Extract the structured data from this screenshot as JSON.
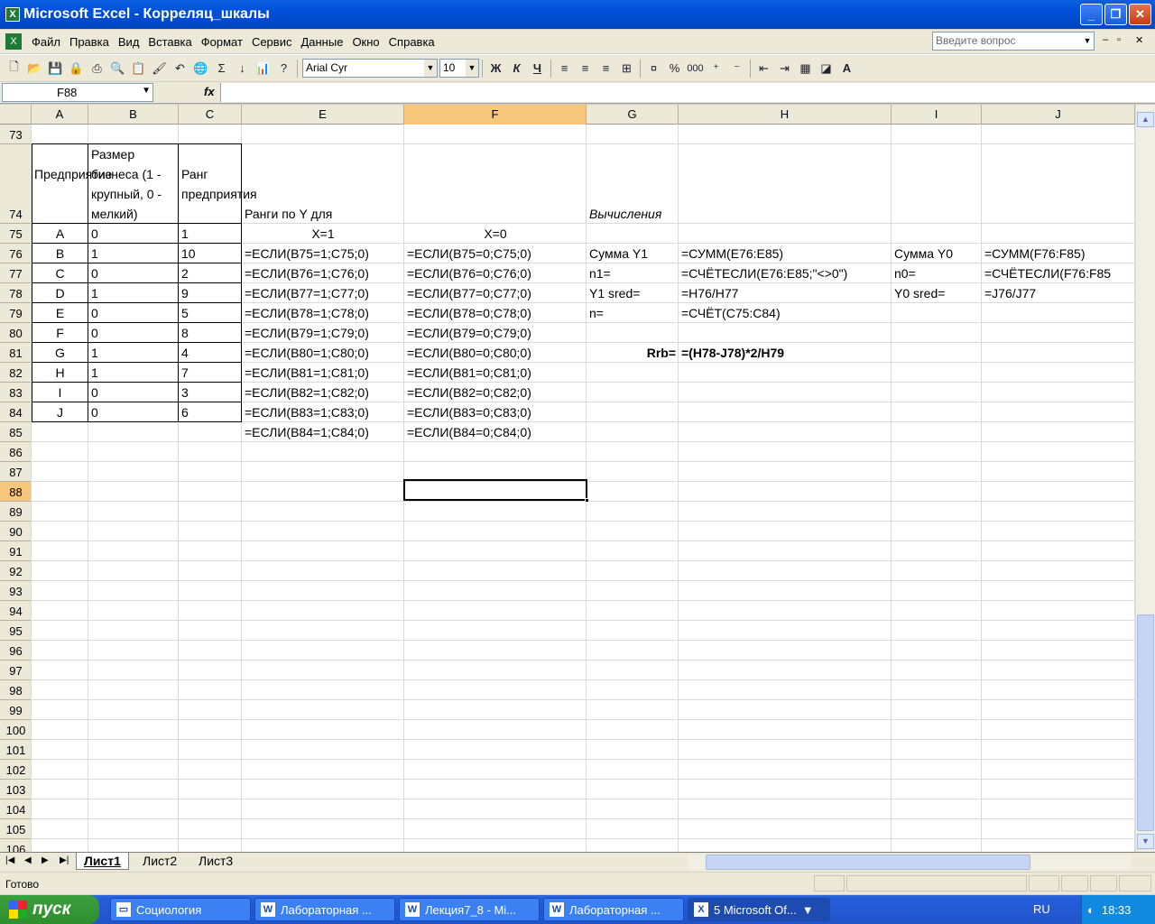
{
  "window": {
    "title": "Microsoft Excel - Корреляц_шкалы"
  },
  "menu": {
    "items": [
      "Файл",
      "Правка",
      "Вид",
      "Вставка",
      "Формат",
      "Сервис",
      "Данные",
      "Окно",
      "Справка"
    ],
    "ask_placeholder": "Введите вопрос"
  },
  "toolbar": {
    "font": "Arial Cyr",
    "size": "10",
    "bold": "Ж",
    "italic": "К",
    "underline": "Ч",
    "percent": "%",
    "thousands": "000"
  },
  "formula_bar": {
    "name_box": "F88",
    "fx": "fx",
    "formula": ""
  },
  "columns": [
    "A",
    "B",
    "C",
    "E",
    "F",
    "G",
    "H",
    "I",
    "J"
  ],
  "rows": [
    "73",
    "74",
    "75",
    "76",
    "77",
    "78",
    "79",
    "80",
    "81",
    "82",
    "83",
    "84",
    "85",
    "86",
    "87",
    "88",
    "89",
    "90",
    "91",
    "92",
    "93",
    "94",
    "95",
    "96",
    "97",
    "98",
    "99",
    "100",
    "101",
    "102",
    "103",
    "104",
    "105",
    "106"
  ],
  "sheet": {
    "a74": "Предприятие",
    "b74": "Размер бизнеса (1 - крупный, 0 - мелкий)",
    "c74": "Ранг предприятия",
    "e74": "Ранги по Y для",
    "g74": "Вычисления",
    "e75": "X=1",
    "f75": "X=0",
    "table_a": [
      "A",
      "B",
      "C",
      "D",
      "E",
      "F",
      "G",
      "H",
      "I",
      "J"
    ],
    "table_b": [
      "0",
      "1",
      "0",
      "1",
      "0",
      "0",
      "1",
      "1",
      "0",
      "0"
    ],
    "table_c": [
      "1",
      "10",
      "2",
      "9",
      "5",
      "8",
      "4",
      "7",
      "3",
      "6"
    ],
    "col_e": [
      "=ЕСЛИ(B75=1;C75;0)",
      "=ЕСЛИ(B76=1;C76;0)",
      "=ЕСЛИ(B77=1;C77;0)",
      "=ЕСЛИ(B78=1;C78;0)",
      "=ЕСЛИ(B79=1;C79;0)",
      "=ЕСЛИ(B80=1;C80;0)",
      "=ЕСЛИ(B81=1;C81;0)",
      "=ЕСЛИ(B82=1;C82;0)",
      "=ЕСЛИ(B83=1;C83;0)",
      "=ЕСЛИ(B84=1;C84;0)"
    ],
    "col_f": [
      "=ЕСЛИ(B75=0;C75;0)",
      "=ЕСЛИ(B76=0;C76;0)",
      "=ЕСЛИ(B77=0;C77;0)",
      "=ЕСЛИ(B78=0;C78;0)",
      "=ЕСЛИ(B79=0;C79;0)",
      "=ЕСЛИ(B80=0;C80;0)",
      "=ЕСЛИ(B81=0;C81;0)",
      "=ЕСЛИ(B82=0;C82;0)",
      "=ЕСЛИ(B83=0;C83;0)",
      "=ЕСЛИ(B84=0;C84;0)"
    ],
    "g76": "Сумма Y1",
    "h76": "=СУММ(E76:E85)",
    "i76": "Сумма Y0",
    "j76": "=СУММ(F76:F85)",
    "g77": "n1=",
    "h77": "=СЧЁТЕСЛИ(E76:E85;\"<>0\")",
    "i77": "n0=",
    "j77": "=СЧЁТЕСЛИ(F76:F85",
    "g78": "Y1 sred=",
    "h78": "=H76/H77",
    "i78": "Y0 sred=",
    "j78": "=J76/J77",
    "g79": "n=",
    "h79": "=СЧЁТ(C75:C84)",
    "g81": "Rrb=",
    "h81": "=(H78-J78)*2/H79"
  },
  "tabs": [
    "Лист1",
    "Лист2",
    "Лист3"
  ],
  "status": "Готово",
  "taskbar": {
    "start": "пуск",
    "items": [
      "Социология",
      "Лабораторная ...",
      "Лекция7_8 - Mi...",
      "Лабораторная ...",
      "5 Microsoft Of..."
    ],
    "lang": "RU",
    "clock": "18:33"
  }
}
